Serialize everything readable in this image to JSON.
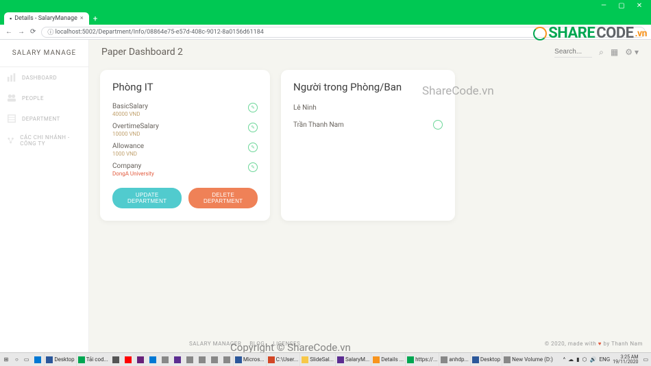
{
  "browser": {
    "tab_title": "Details - SalaryManage",
    "url": "localhost:5002/Department/Info/08864e75-e57d-408c-9012-8a0156d61184"
  },
  "logo": {
    "part1": "SHARE",
    "part2": "CODE",
    "vn": ".vn"
  },
  "sidebar": {
    "brand": "SALARY MANAGE",
    "items": [
      {
        "label": "DASHBOARD",
        "icon": "dashboard"
      },
      {
        "label": "PEOPLE",
        "icon": "people"
      },
      {
        "label": "DEPARTMENT",
        "icon": "department"
      },
      {
        "label": "CÁC CHI NHÁNH - CÔNG TY",
        "icon": "branch"
      }
    ]
  },
  "header": {
    "title": "Paper Dashboard 2",
    "search_placeholder": "Search..."
  },
  "dept_card": {
    "title": "Phòng IT",
    "fields": [
      {
        "label": "BasicSalary",
        "value": "40000 VND"
      },
      {
        "label": "OvertimeSalary",
        "value": "10000 VND"
      },
      {
        "label": "Allowance",
        "value": "1000 VND"
      },
      {
        "label": "Company",
        "value": "DongA University"
      }
    ],
    "update_label": "UPDATE DEPARTMENT",
    "delete_label": "DELETE DEPARTMENT"
  },
  "people_card": {
    "title": "Người trong Phòng/Ban",
    "people": [
      {
        "name": "Lê Ninh"
      },
      {
        "name": "Trần Thanh Nam"
      }
    ]
  },
  "footer": {
    "links": [
      "SALARY MANAGER",
      "BLOG",
      "LICENSES"
    ],
    "copyright_prefix": "© 2020, made with ",
    "copyright_suffix": " by Thanh Nam"
  },
  "watermarks": {
    "wm1": "ShareCode.vn",
    "wm2": "Copyright © ShareCode.vn"
  },
  "taskbar": {
    "items": [
      "Desktop",
      "Tải cod...",
      "Micros...",
      "C:\\User...",
      "SlideSal...",
      "SalaryM...",
      "Details ...",
      "https://...",
      "anhdp...",
      "Desktop",
      "New Volume (D:)"
    ],
    "tray": {
      "lang": "ENG",
      "time": "3:25 AM",
      "date": "19/11/2020"
    }
  }
}
